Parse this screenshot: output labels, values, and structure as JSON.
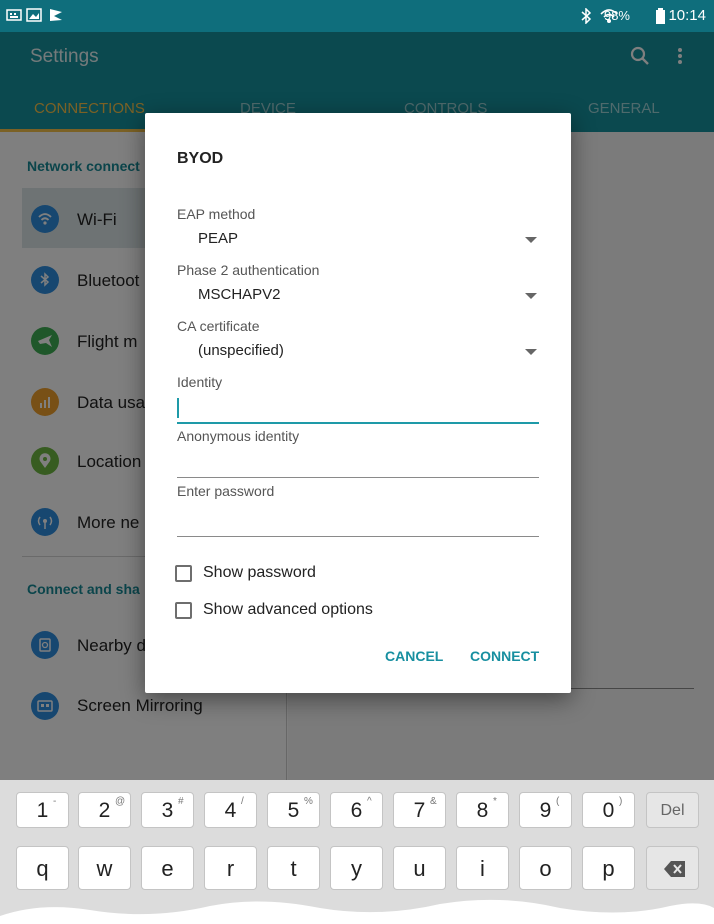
{
  "status_bar": {
    "battery_percent": "98%",
    "time": "10:14"
  },
  "app_bar": {
    "title": "Settings",
    "tabs": [
      "CONNECTIONS",
      "DEVICE",
      "CONTROLS",
      "GENERAL"
    ],
    "active_tab": "CONNECTIONS"
  },
  "settings_list": {
    "section_network": "Network connect",
    "section_connect": "Connect and sha",
    "items": [
      {
        "label": "Wi-Fi",
        "icon": "wifi-icon",
        "color": "#2f8fe0"
      },
      {
        "label": "Bluetoot",
        "icon": "bluetooth-icon",
        "color": "#2f8fe0"
      },
      {
        "label": "Flight m",
        "icon": "airplane-icon",
        "color": "#3fae54"
      },
      {
        "label": "Data usa",
        "icon": "data-usage-icon",
        "color": "#f0a02c"
      },
      {
        "label": "Location",
        "icon": "location-icon",
        "color": "#6fb843"
      },
      {
        "label": "More ne",
        "icon": "more-networks-icon",
        "color": "#2f8fe0"
      },
      {
        "label": "Nearby d",
        "icon": "nearby-device-icon",
        "color": "#2f8fe0"
      },
      {
        "label": "Screen Mirroring",
        "icon": "screen-mirroring-icon",
        "color": "#2f8fe0"
      }
    ]
  },
  "dialog": {
    "title": "BYOD",
    "eap_method_label": "EAP method",
    "eap_method_value": "PEAP",
    "phase2_label": "Phase 2 authentication",
    "phase2_value": "MSCHAPV2",
    "ca_cert_label": "CA certificate",
    "ca_cert_value": "(unspecified)",
    "identity_label": "Identity",
    "identity_value": "",
    "anon_identity_label": "Anonymous identity",
    "anon_identity_value": "",
    "password_label": "Enter password",
    "password_value": "",
    "show_password_label": "Show password",
    "show_advanced_label": "Show advanced options",
    "cancel_label": "CANCEL",
    "connect_label": "CONNECT"
  },
  "keyboard": {
    "number_row": [
      {
        "main": "1",
        "sup": "-"
      },
      {
        "main": "2",
        "sup": "@"
      },
      {
        "main": "3",
        "sup": "#"
      },
      {
        "main": "4",
        "sup": "/"
      },
      {
        "main": "5",
        "sup": "%"
      },
      {
        "main": "6",
        "sup": "^"
      },
      {
        "main": "7",
        "sup": "&"
      },
      {
        "main": "8",
        "sup": "*"
      },
      {
        "main": "9",
        "sup": "("
      },
      {
        "main": "0",
        "sup": ")"
      }
    ],
    "delete_label": "Del",
    "letter_row": [
      "q",
      "w",
      "e",
      "r",
      "t",
      "y",
      "u",
      "i",
      "o",
      "p"
    ],
    "backspace_icon": "backspace-icon"
  },
  "colors": {
    "status_bar": "#0f6e7c",
    "app_bar": "#17929e",
    "accent_tab": "#f7c24a",
    "dialog_button": "#178fa0",
    "focus_line": "#1e9aa8"
  }
}
